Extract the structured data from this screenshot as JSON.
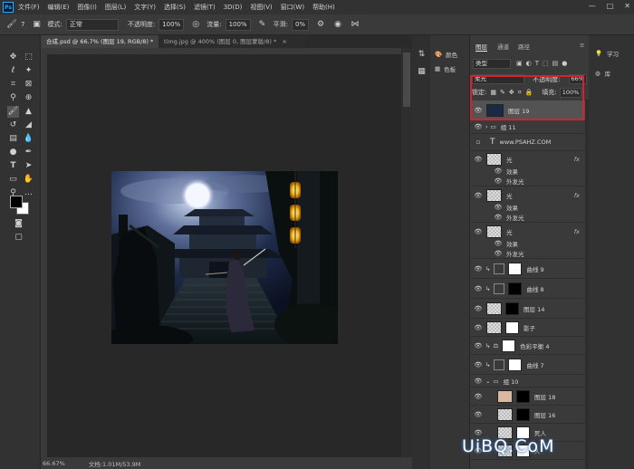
{
  "app": {
    "logo": "Ps"
  },
  "menubar": {
    "items": [
      "文件(F)",
      "编辑(E)",
      "图像(I)",
      "图层(L)",
      "文字(Y)",
      "选择(S)",
      "滤镜(T)",
      "3D(D)",
      "视图(V)",
      "窗口(W)",
      "帮助(H)"
    ],
    "window_controls": [
      "—",
      "□",
      "✕"
    ]
  },
  "options_bar": {
    "brush_size": "7",
    "mode_label": "模式:",
    "mode_value": "正常",
    "opacity_label": "不透明度:",
    "opacity_value": "100%",
    "flow_label": "流量:",
    "flow_value": "100%",
    "smoothing_label": "平滑:",
    "smoothing_value": "0%"
  },
  "tabs": [
    {
      "label": "合成.psd @ 66.7% (图层 19, RGB/8) *",
      "close": "×"
    },
    {
      "label": "timg.jpg @ 400% (图层 0, 图层蒙版/8) *",
      "close": "×"
    }
  ],
  "status": {
    "zoom": "66.67%",
    "doc": "文档:1.01M/53.9M"
  },
  "side_panel": {
    "items": [
      {
        "label": "颜色",
        "icon": "palette-icon"
      },
      {
        "label": "色板",
        "icon": "grid-icon"
      }
    ]
  },
  "right_panel": {
    "items": [
      {
        "label": "学习",
        "icon": "lightbulb-icon"
      },
      {
        "label": "库",
        "icon": "library-icon"
      }
    ]
  },
  "layers_panel": {
    "tabs": [
      "图层",
      "通道",
      "路径"
    ],
    "filter_kind": "类型",
    "blend_mode": "柔光",
    "opacity_label": "不透明度:",
    "opacity_value": "66%",
    "lock_label": "锁定:",
    "fill_label": "填充:",
    "fill_value": "100%",
    "layers": [
      {
        "name": "图层 19",
        "type": "image",
        "selected": true
      },
      {
        "name": "组 11",
        "type": "group"
      },
      {
        "name": "www.PSAHZ.COM",
        "type": "text"
      },
      {
        "name": "光",
        "type": "raster",
        "fx": "fx",
        "effects_label": "效果",
        "effect": "外发光"
      },
      {
        "name": "光",
        "type": "raster",
        "fx": "fx",
        "effects_label": "效果",
        "effect": "外发光"
      },
      {
        "name": "光",
        "type": "raster",
        "fx": "fx",
        "effects_label": "效果",
        "effect": "外发光"
      },
      {
        "name": "曲线 9",
        "type": "adjust"
      },
      {
        "name": "曲线 8",
        "type": "adjust"
      },
      {
        "name": "图层 14",
        "type": "masked"
      },
      {
        "name": "影子",
        "type": "masked"
      },
      {
        "name": "色彩平衡 4",
        "type": "adjust"
      },
      {
        "name": "曲线 7",
        "type": "adjust"
      },
      {
        "name": "组 10",
        "type": "group"
      },
      {
        "name": "图层 18",
        "type": "masked"
      },
      {
        "name": "图层 16",
        "type": "masked"
      },
      {
        "name": "死人",
        "type": "masked"
      },
      {
        "name": "人",
        "type": "masked"
      }
    ]
  },
  "watermark": "UiBQ.CoM",
  "colors": {
    "highlight": "#d4232b",
    "panel": "#3a3a3a",
    "canvas": "#282828"
  }
}
